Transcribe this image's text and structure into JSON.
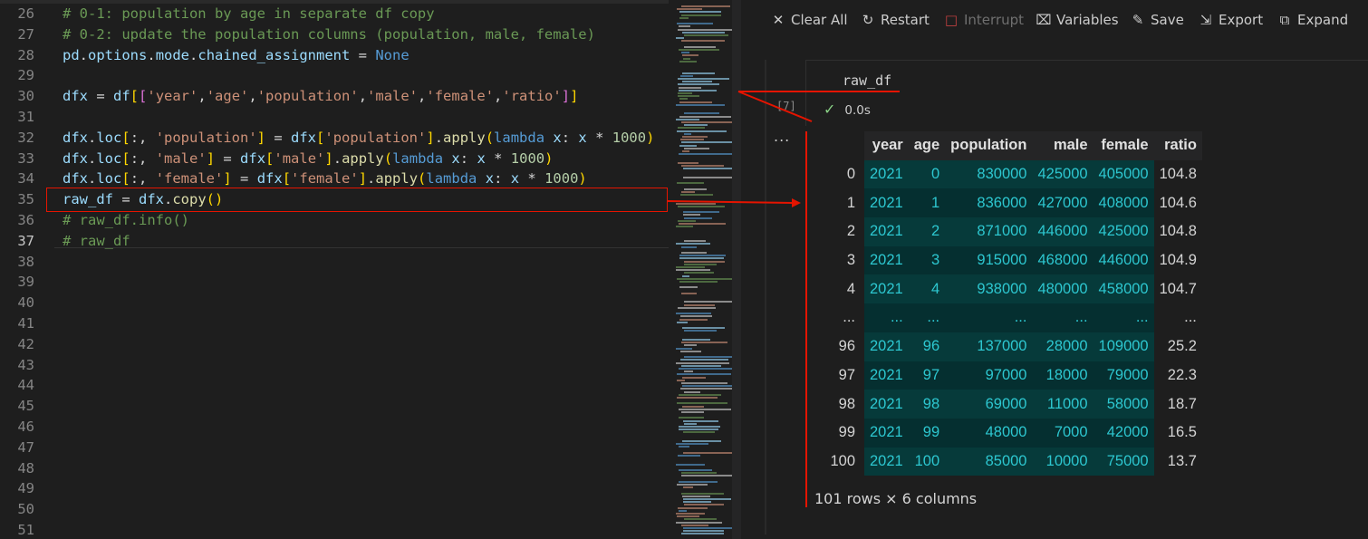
{
  "editor": {
    "lines": [
      {
        "n": "26",
        "html": "<span class='k-cmt'># 0-1: population by age in separate df copy</span>"
      },
      {
        "n": "27",
        "html": "<span class='k-cmt'># 0-2: update the population columns (population, male, female)</span>"
      },
      {
        "n": "28",
        "html": "<span class='k-var'>pd</span>.<span class='k-var'>options</span>.<span class='k-var'>mode</span>.<span class='k-var'>chained_assignment</span> = <span class='k-kw'>None</span>"
      },
      {
        "n": "29",
        "html": ""
      },
      {
        "n": "30",
        "html": "<span class='k-var'>dfx</span> = <span class='k-var'>df</span><span class='k-br1'>[</span><span class='k-br2'>[</span><span class='k-str'>'year'</span>,<span class='k-str'>'age'</span>,<span class='k-str'>'population'</span>,<span class='k-str'>'male'</span>,<span class='k-str'>'female'</span>,<span class='k-str'>'ratio'</span><span class='k-br2'>]</span><span class='k-br1'>]</span>"
      },
      {
        "n": "31",
        "html": ""
      },
      {
        "n": "32",
        "html": "<span class='k-var'>dfx</span>.<span class='k-var'>loc</span><span class='k-br1'>[</span>:, <span class='k-str'>'population'</span><span class='k-br1'>]</span> = <span class='k-var'>dfx</span><span class='k-br1'>[</span><span class='k-str'>'population'</span><span class='k-br1'>]</span>.<span class='k-fn'>apply</span><span class='k-br1'>(</span><span class='k-kw'>lambda</span> <span class='k-var'>x</span>: <span class='k-var'>x</span> * <span class='k-num'>1000</span><span class='k-br1'>)</span>"
      },
      {
        "n": "33",
        "html": "<span class='k-var'>dfx</span>.<span class='k-var'>loc</span><span class='k-br1'>[</span>:, <span class='k-str'>'male'</span><span class='k-br1'>]</span> = <span class='k-var'>dfx</span><span class='k-br1'>[</span><span class='k-str'>'male'</span><span class='k-br1'>]</span>.<span class='k-fn'>apply</span><span class='k-br1'>(</span><span class='k-kw'>lambda</span> <span class='k-var'>x</span>: <span class='k-var'>x</span> * <span class='k-num'>1000</span><span class='k-br1'>)</span>"
      },
      {
        "n": "34",
        "html": "<span class='k-var'>dfx</span>.<span class='k-var'>loc</span><span class='k-br1'>[</span>:, <span class='k-str'>'female'</span><span class='k-br1'>]</span> = <span class='k-var'>dfx</span><span class='k-br1'>[</span><span class='k-str'>'female'</span><span class='k-br1'>]</span>.<span class='k-fn'>apply</span><span class='k-br1'>(</span><span class='k-kw'>lambda</span> <span class='k-var'>x</span>: <span class='k-var'>x</span> * <span class='k-num'>1000</span><span class='k-br1'>)</span>"
      },
      {
        "n": "35",
        "html": "<span class='k-var'>raw_df</span> = <span class='k-var'>dfx</span>.<span class='k-fn'>copy</span><span class='k-br1'>()</span>"
      },
      {
        "n": "36",
        "html": "<span class='k-cmt'># raw_df.info()</span>"
      },
      {
        "n": "37",
        "html": "<span class='k-cmt'># raw_df</span>",
        "active": true
      },
      {
        "n": "38",
        "html": ""
      },
      {
        "n": "39",
        "html": ""
      },
      {
        "n": "40",
        "html": ""
      },
      {
        "n": "41",
        "html": ""
      },
      {
        "n": "42",
        "html": ""
      },
      {
        "n": "43",
        "html": ""
      },
      {
        "n": "44",
        "html": ""
      },
      {
        "n": "45",
        "html": ""
      },
      {
        "n": "46",
        "html": ""
      },
      {
        "n": "47",
        "html": ""
      },
      {
        "n": "48",
        "html": ""
      },
      {
        "n": "49",
        "html": ""
      },
      {
        "n": "50",
        "html": ""
      },
      {
        "n": "51",
        "html": ""
      }
    ]
  },
  "toolbar": {
    "clear_all": "Clear All",
    "restart": "Restart",
    "interrupt": "Interrupt",
    "variables": "Variables",
    "save": "Save",
    "export": "Export",
    "expand": "Expand"
  },
  "cell": {
    "exec_count": "[7]",
    "code": "raw_df",
    "status_time": "0.0s",
    "more": "...",
    "table": {
      "columns": [
        "",
        "year",
        "age",
        "population",
        "male",
        "female",
        "ratio"
      ],
      "rows": [
        [
          "0",
          "2021",
          "0",
          "830000",
          "425000",
          "405000",
          "104.8"
        ],
        [
          "1",
          "2021",
          "1",
          "836000",
          "427000",
          "408000",
          "104.6"
        ],
        [
          "2",
          "2021",
          "2",
          "871000",
          "446000",
          "425000",
          "104.8"
        ],
        [
          "3",
          "2021",
          "3",
          "915000",
          "468000",
          "446000",
          "104.9"
        ],
        [
          "4",
          "2021",
          "4",
          "938000",
          "480000",
          "458000",
          "104.7"
        ],
        [
          "...",
          "...",
          "...",
          "...",
          "...",
          "...",
          "..."
        ],
        [
          "96",
          "2021",
          "96",
          "137000",
          "28000",
          "109000",
          "25.2"
        ],
        [
          "97",
          "2021",
          "97",
          "97000",
          "18000",
          "79000",
          "22.3"
        ],
        [
          "98",
          "2021",
          "98",
          "69000",
          "11000",
          "58000",
          "18.7"
        ],
        [
          "99",
          "2021",
          "99",
          "48000",
          "7000",
          "42000",
          "16.5"
        ],
        [
          "100",
          "2021",
          "100",
          "85000",
          "10000",
          "75000",
          "13.7"
        ]
      ]
    },
    "shape": "101 rows × 6 columns"
  },
  "colors": {
    "accent_red": "#e51400",
    "cell_bg": "#063a3a",
    "cell_text": "#2dc7d0"
  }
}
